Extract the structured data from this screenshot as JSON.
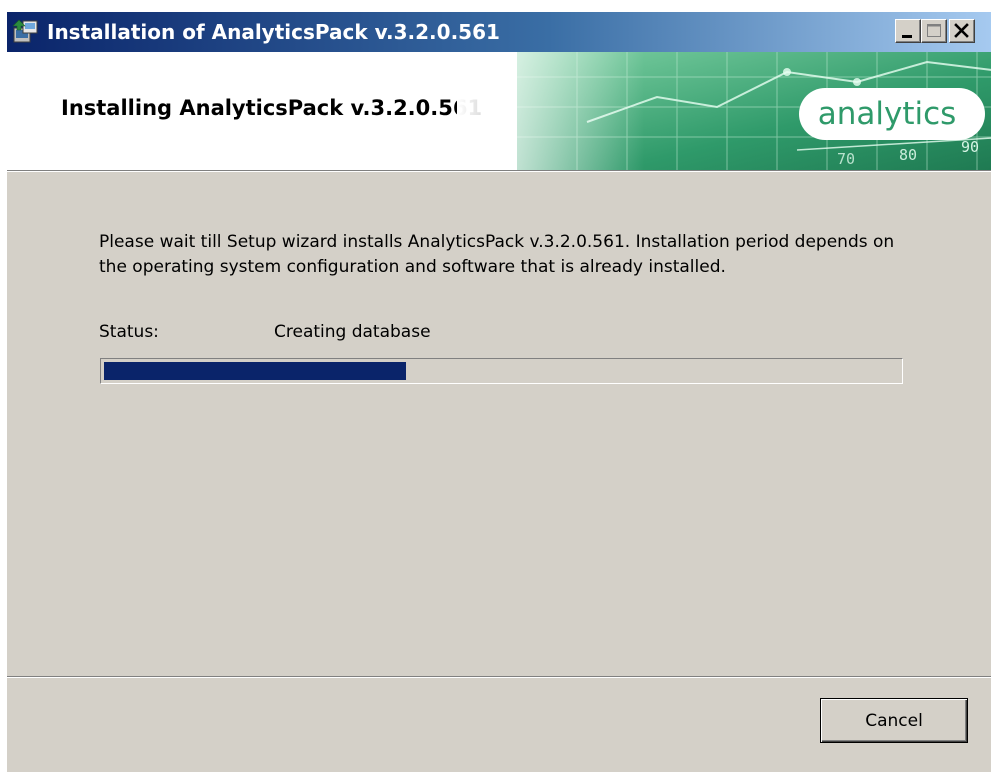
{
  "window": {
    "title": "Installation of AnalyticsPack v.3.2.0.561",
    "icon": "installer-icon",
    "controls": [
      "minimize-icon",
      "maximize-icon",
      "close-icon"
    ]
  },
  "banner": {
    "heading": "Installing AnalyticsPack v.3.2.0.561",
    "logo_text": "analytics",
    "art_numbers": [
      "70",
      "80",
      "90"
    ]
  },
  "body": {
    "description": "Please wait till Setup wizard installs AnalyticsPack v.3.2.0.561. Installation period depends on the operating system configuration and software that is already installed.",
    "status_label": "Status:",
    "status_value": "Creating database",
    "progress_percent": 38
  },
  "footer": {
    "cancel_label": "Cancel"
  },
  "colors": {
    "title_bar_start": "#0a246a",
    "progress_fill": "#0a246a",
    "dialog_face": "#d4d0c8",
    "brand_green": "#2f9a6a"
  }
}
